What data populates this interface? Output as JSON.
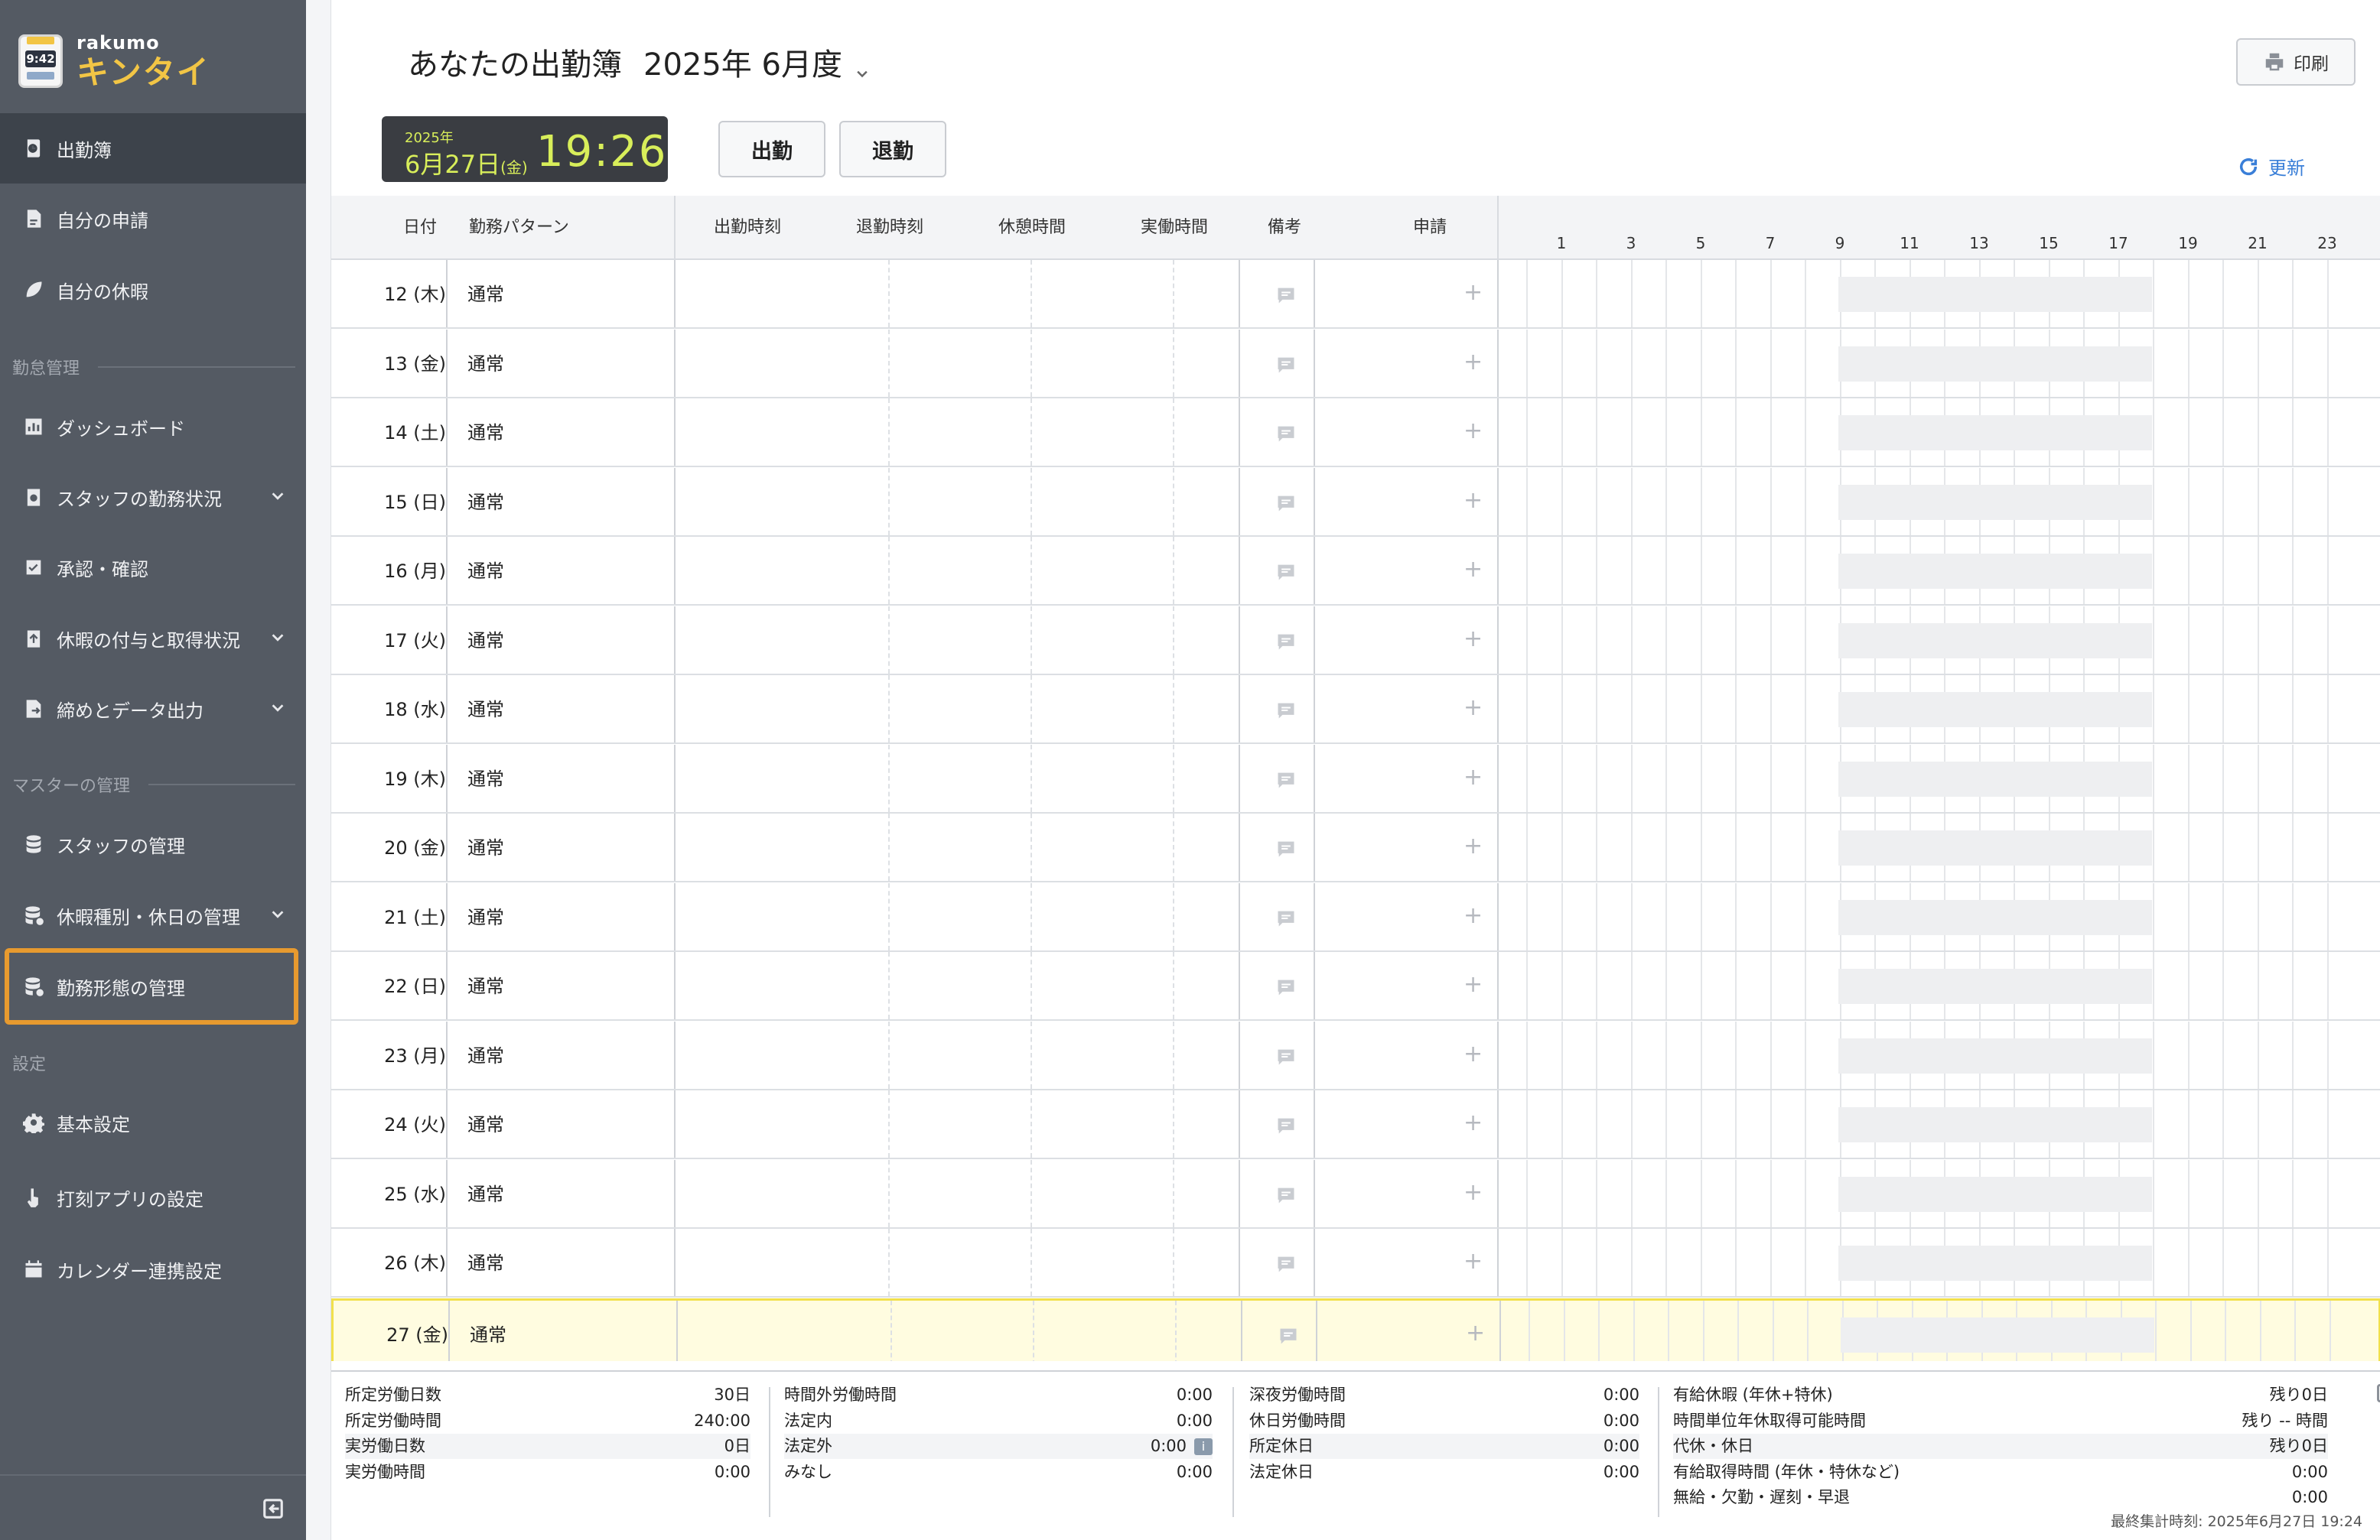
{
  "logo": {
    "small": "rakumo",
    "big": "キンタイ",
    "clock": "9:42"
  },
  "sidebar": {
    "items": [
      {
        "id": "attendance",
        "label": "出勤簿",
        "icon": "clock-book-icon"
      },
      {
        "id": "my-requests",
        "label": "自分の申請",
        "icon": "document-icon"
      },
      {
        "id": "my-leave",
        "label": "自分の休暇",
        "icon": "leaf-icon"
      },
      {
        "id": "dashboard",
        "label": "ダッシュボード",
        "icon": "chart-icon"
      },
      {
        "id": "staff-status",
        "label": "スタッフの勤務状況",
        "icon": "clipboard-clock-icon"
      },
      {
        "id": "approval",
        "label": "承認・確認",
        "icon": "check-document-icon"
      },
      {
        "id": "leave-grant",
        "label": "休暇の付与と取得状況",
        "icon": "clipboard-upload-icon"
      },
      {
        "id": "closing",
        "label": "締めとデータ出力",
        "icon": "export-document-icon"
      },
      {
        "id": "staff-manage",
        "label": "スタッフの管理",
        "icon": "database-icon"
      },
      {
        "id": "leave-type-manage",
        "label": "休暇種別・休日の管理",
        "icon": "database-gear-icon"
      },
      {
        "id": "work-style-manage",
        "label": "勤務形態の管理",
        "icon": "database-clock-icon"
      },
      {
        "id": "basic-settings",
        "label": "基本設定",
        "icon": "gear-icon"
      },
      {
        "id": "stamp-app-settings",
        "label": "打刻アプリの設定",
        "icon": "hand-tap-icon"
      },
      {
        "id": "calendar-settings",
        "label": "カレンダー連携設定",
        "icon": "calendar-icon"
      }
    ],
    "sections": {
      "attendance_mgmt": "勤怠管理",
      "master_mgmt": "マスターの管理",
      "settings": "設定"
    }
  },
  "header": {
    "title": "あなたの出勤簿",
    "month": "2025年 6月度",
    "print_label": "印刷",
    "refresh_label": "更新"
  },
  "clock": {
    "year": "2025年",
    "date": "6月27日",
    "weekday": "(金)",
    "time": "19:26"
  },
  "actions": {
    "clock_in": "出勤",
    "clock_out": "退勤"
  },
  "table": {
    "columns": {
      "date": "日付",
      "pattern": "勤務パターン",
      "start": "出勤時刻",
      "end": "退勤時刻",
      "break": "休憩時間",
      "actual": "実働時間",
      "memo": "備考",
      "request": "申請"
    },
    "hour_ticks": [
      "1",
      "3",
      "5",
      "7",
      "9",
      "11",
      "13",
      "15",
      "17",
      "19",
      "21",
      "23"
    ],
    "rows": [
      {
        "date": "12 (木)",
        "pattern": "通常"
      },
      {
        "date": "13 (金)",
        "pattern": "通常"
      },
      {
        "date": "14 (土)",
        "pattern": "通常"
      },
      {
        "date": "15 (日)",
        "pattern": "通常"
      },
      {
        "date": "16 (月)",
        "pattern": "通常"
      },
      {
        "date": "17 (火)",
        "pattern": "通常"
      },
      {
        "date": "18 (水)",
        "pattern": "通常"
      },
      {
        "date": "19 (木)",
        "pattern": "通常"
      },
      {
        "date": "20 (金)",
        "pattern": "通常"
      },
      {
        "date": "21 (土)",
        "pattern": "通常"
      },
      {
        "date": "22 (日)",
        "pattern": "通常"
      },
      {
        "date": "23 (月)",
        "pattern": "通常"
      },
      {
        "date": "24 (火)",
        "pattern": "通常"
      },
      {
        "date": "25 (水)",
        "pattern": "通常"
      },
      {
        "date": "26 (木)",
        "pattern": "通常"
      },
      {
        "date": "27 (金)",
        "pattern": "通常",
        "today": true
      }
    ]
  },
  "summary": {
    "col1": [
      {
        "label": "所定労働日数",
        "value": "30日"
      },
      {
        "label": "所定労働時間",
        "value": "240:00"
      },
      {
        "label": "実労働日数",
        "value": "0日"
      },
      {
        "label": "実労働時間",
        "value": "0:00"
      }
    ],
    "col2": [
      {
        "label": "時間外労働時間",
        "value": "0:00"
      },
      {
        "label": "法定内",
        "value": "0:00"
      },
      {
        "label": "法定外",
        "value": "0:00"
      },
      {
        "label": "みなし",
        "value": "0:00"
      }
    ],
    "col3": [
      {
        "label": "深夜労働時間",
        "value": "0:00"
      },
      {
        "label": "休日労働時間",
        "value": "0:00"
      },
      {
        "label": "所定休日",
        "value": "0:00"
      },
      {
        "label": "法定休日",
        "value": "0:00"
      }
    ],
    "col4": [
      {
        "label": "有給休暇 (年休+特休)",
        "value": "残り0日"
      },
      {
        "label": "時間単位年休取得可能時間",
        "value": "残り -- 時間"
      },
      {
        "label": "代休・休日",
        "value": "残り0日"
      },
      {
        "label": "有給取得時間 (年休・特休など)",
        "value": "0:00"
      },
      {
        "label": "無給・欠勤・遅刻・早退",
        "value": "0:00"
      }
    ],
    "info_badge": "i",
    "last_calc": "最終集計時刻: 2025年6月27日 19:24"
  },
  "colors": {
    "sidebar_bg": "#545a63",
    "active_bg": "#3d434b",
    "highlight": "#e79a2f",
    "clock_text": "#d8ee5a",
    "today_row": "#fffce0",
    "link": "#3a7fd8"
  }
}
